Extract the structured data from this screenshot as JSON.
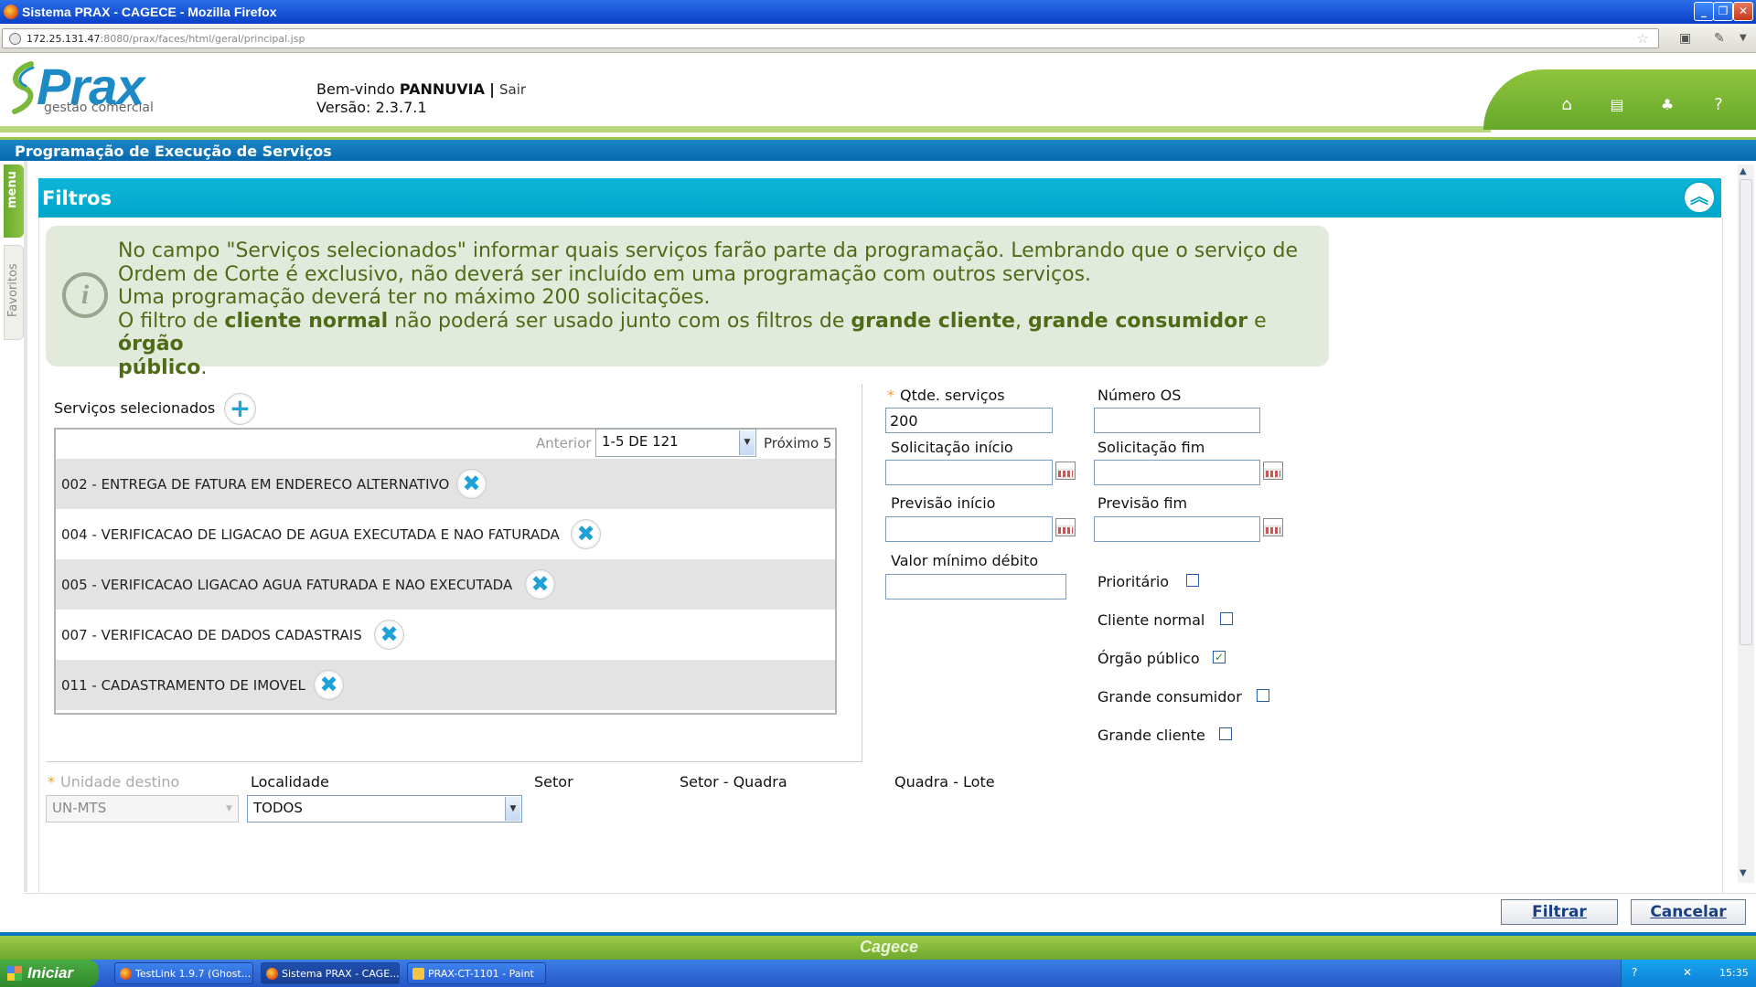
{
  "window": {
    "title": "Sistema PRAX - CAGECE - Mozilla Firefox"
  },
  "browser": {
    "url_host": "172.25.131.47",
    "url_rest": ":8080/prax/faces/html/geral/principal.jsp"
  },
  "header": {
    "logo": "Prax",
    "logo_sub": "gestão comercial",
    "welcome_prefix": "Bem-vindo",
    "user": "PANNUVIA",
    "separator": "|",
    "logout": "Sair",
    "version": "Versão: 2.3.7.1",
    "icons": [
      "home-icon",
      "print-icon",
      "sitemap-icon",
      "help-icon"
    ]
  },
  "page_title": "Programação de Execução de Serviços",
  "side": {
    "menu": "menu",
    "favorites": "Favoritos"
  },
  "filtros": {
    "title": "Filtros",
    "info_line1": "No campo \"Serviços selecionados\" informar quais serviços farão parte da programação. Lembrando que o serviço de",
    "info_line2": "Ordem de Corte é exclusivo, não deverá ser incluído em uma programação com outros serviços.",
    "info_line3": "Uma programação deverá ter no máximo 200 solicitações.",
    "info_l4_a": "O filtro de ",
    "info_l4_b": "cliente normal",
    "info_l4_c": " não poderá ser usado junto com os filtros de ",
    "info_l4_d": "grande cliente",
    "info_l4_e": ", ",
    "info_l4_f": "grande consumidor",
    "info_l4_g": " e ",
    "info_l4_h": "órgão",
    "info_l5_a": "público",
    "info_l5_b": "."
  },
  "servicos": {
    "label": "Serviços selecionados",
    "pager": {
      "previous": "Anterior",
      "selected": "1-5 DE 121",
      "next": "Próximo 5"
    },
    "rows": [
      "002 - ENTREGA DE FATURA EM ENDERECO ALTERNATIVO",
      "004 - VERIFICACAO DE LIGACAO DE AGUA EXECUTADA E NAO FATURADA",
      "005 - VERIFICACAO LIGACAO AGUA FATURADA E NAO EXECUTADA",
      "007 - VERIFICACAO DE DADOS CADASTRAIS",
      "011 - CADASTRAMENTO DE IMOVEL"
    ]
  },
  "form": {
    "required_mark": "*",
    "qtde_label": "Qtde. serviços",
    "qtde_value": "200",
    "numero_os_label": "Número OS",
    "numero_os_value": "",
    "sol_inicio_label": "Solicitação início",
    "sol_fim_label": "Solicitação fim",
    "prev_inicio_label": "Previsão início",
    "prev_fim_label": "Previsão fim",
    "valor_min_label": "Valor mínimo débito",
    "prioritario_label": "Prioritário",
    "prioritario_checked": false,
    "cliente_normal_label": "Cliente normal",
    "cliente_normal_checked": false,
    "orgao_publico_label": "Órgão público",
    "orgao_publico_checked": true,
    "grande_consumidor_label": "Grande consumidor",
    "grande_consumidor_checked": false,
    "grande_cliente_label": "Grande cliente",
    "grande_cliente_checked": false,
    "check_mark": "✓"
  },
  "location": {
    "unidade_label": "Unidade destino",
    "unidade_value": "UN-MTS",
    "localidade_label": "Localidade",
    "localidade_value": "TODOS",
    "setor_label": "Setor",
    "setor_quadra_label": "Setor - Quadra",
    "quadra_lote_label": "Quadra - Lote"
  },
  "actions": {
    "filtrar": "Filtrar",
    "cancelar": "Cancelar"
  },
  "footer": {
    "brand": "Cagece"
  },
  "taskbar": {
    "start": "Iniciar",
    "tasks": [
      "TestLink 1.9.7 (Ghost...",
      "Sistema PRAX - CAGE...",
      "PRAX-CT-1101 - Paint"
    ],
    "clock": "15:35"
  }
}
